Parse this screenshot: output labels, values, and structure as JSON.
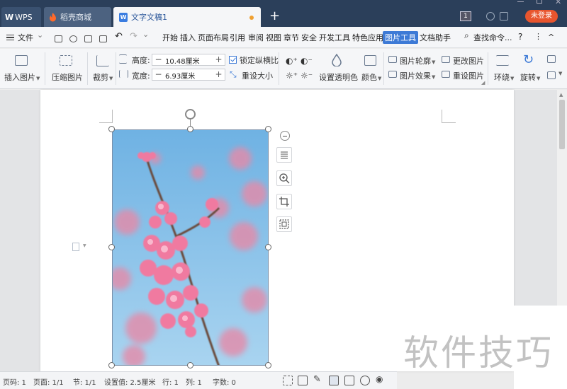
{
  "titlebar": {
    "tabs": [
      {
        "label": "WPS",
        "logo_text": "W"
      },
      {
        "label": "稻壳商城"
      },
      {
        "label": "文字文稿1",
        "active": true,
        "unsaved_dot_color": "#f0a030"
      }
    ],
    "new_tab": "+",
    "page_indicator": "1",
    "login_label": "未登录",
    "login_color": "#e8552e"
  },
  "menubar": {
    "file_label": "文件",
    "items": [
      "开始",
      "插入",
      "页面布局",
      "引用",
      "审阅",
      "视图",
      "章节",
      "安全",
      "开发工具",
      "特色应用",
      "图片工具",
      "文档助手"
    ],
    "active_item": "图片工具",
    "search_label": "查找命令...",
    "help_label": "?",
    "more_label": "⋮",
    "collapse_label": "^"
  },
  "ribbon": {
    "insert_picture": "插入图片",
    "compress_picture": "压缩图片",
    "crop": "裁剪",
    "height_label": "高度:",
    "height_value": "10.48厘米",
    "width_label": "宽度:",
    "width_value": "6.93厘米",
    "lock_ratio": "锁定纵横比",
    "reset_size": "重设大小",
    "set_transparent": "设置透明色",
    "color": "颜色",
    "picture_outline": "图片轮廓",
    "picture_effect": "图片效果",
    "change_picture": "更改图片",
    "reset_picture": "重设图片",
    "wrap": "环绕",
    "rotate": "旋转",
    "minus": "−",
    "plus": "+"
  },
  "status": {
    "page_no": "页码: 1",
    "page_count": "页面: 1/1",
    "section": "节: 1/1",
    "setting": "设置值: 2.5厘米",
    "row": "行: 1",
    "col": "列: 1",
    "words": "字数: 0"
  },
  "watermark": "软件技巧"
}
